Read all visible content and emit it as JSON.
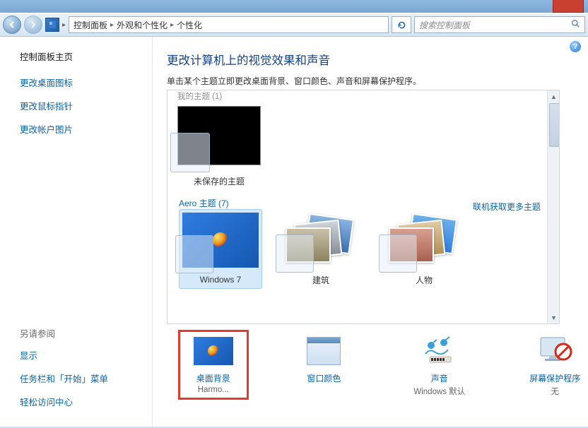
{
  "nav": {
    "breadcrumb": [
      "控制面板",
      "外观和个性化",
      "个性化"
    ],
    "search_placeholder": "搜索控制面板"
  },
  "sidebar": {
    "home": "控制面板主页",
    "links": [
      "更改桌面图标",
      "更改鼠标指针",
      "更改帐户图片"
    ],
    "see_also_header": "另请参阅",
    "see_also": [
      "显示",
      "任务栏和「开始」菜单",
      "轻松访问中心"
    ]
  },
  "content": {
    "header": "更改计算机上的视觉效果和声音",
    "subtext": "单击某个主题立即更改桌面背景、窗口颜色、声音和屏幕保护程序。",
    "my_themes_label_cut": "我的主题 (1)",
    "unsaved_theme": "未保存的主题",
    "get_more_themes": "联机获取更多主题",
    "aero_label": "Aero 主题 (7)",
    "aero_items": [
      "Windows 7",
      "建筑",
      "人物"
    ]
  },
  "bottom": {
    "items": [
      {
        "title": "桌面背景",
        "sub": "Harmo..."
      },
      {
        "title": "窗口颜色",
        "sub": "  "
      },
      {
        "title": "声音",
        "sub": "Windows 默认"
      },
      {
        "title": "屏幕保护程序",
        "sub": "无"
      }
    ]
  }
}
